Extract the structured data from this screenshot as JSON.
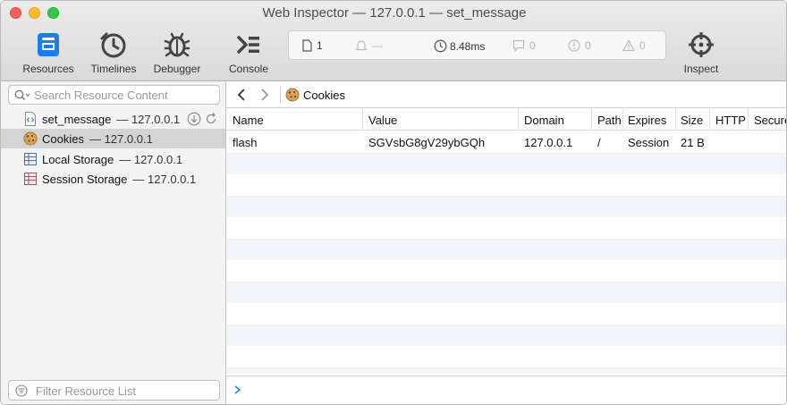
{
  "window": {
    "title": "Web Inspector — 127.0.0.1 — set_message"
  },
  "toolbar": {
    "tabs": [
      {
        "label": "Resources",
        "icon": "resources-icon",
        "active": true
      },
      {
        "label": "Timelines",
        "icon": "timelines-icon"
      },
      {
        "label": "Debugger",
        "icon": "debugger-icon"
      },
      {
        "label": "Console",
        "icon": "console-icon"
      }
    ],
    "inspect_label": "Inspect"
  },
  "dashboard": {
    "resources_count": "1",
    "load_state": "—",
    "load_time": "8.48ms",
    "logs": "0",
    "errors": "0",
    "warnings": "0"
  },
  "sidebar": {
    "search_placeholder": "Search Resource Content",
    "filter_placeholder": "Filter Resource List",
    "items": [
      {
        "name": "set_message",
        "host": "— 127.0.0.1",
        "icon": "document-icon"
      },
      {
        "name": "Cookies",
        "host": "— 127.0.0.1",
        "icon": "cookie-icon",
        "selected": true
      },
      {
        "name": "Local Storage",
        "host": "— 127.0.0.1",
        "icon": "local-storage-icon"
      },
      {
        "name": "Session Storage",
        "host": "— 127.0.0.1",
        "icon": "session-storage-icon"
      }
    ]
  },
  "content": {
    "breadcrumb": "Cookies",
    "columns": [
      "Name",
      "Value",
      "Domain",
      "Path",
      "Expires",
      "Size",
      "HTTP",
      "Secure"
    ],
    "rows": [
      [
        "flash",
        "SGVsbG8gV29ybGQh",
        "127.0.0.1",
        "/",
        "Session",
        "21 B",
        "",
        ""
      ]
    ]
  },
  "colors": {
    "accent": "#1a7ef2",
    "row_alt": "#f2f6fc",
    "selection": "#d4d4d4"
  }
}
